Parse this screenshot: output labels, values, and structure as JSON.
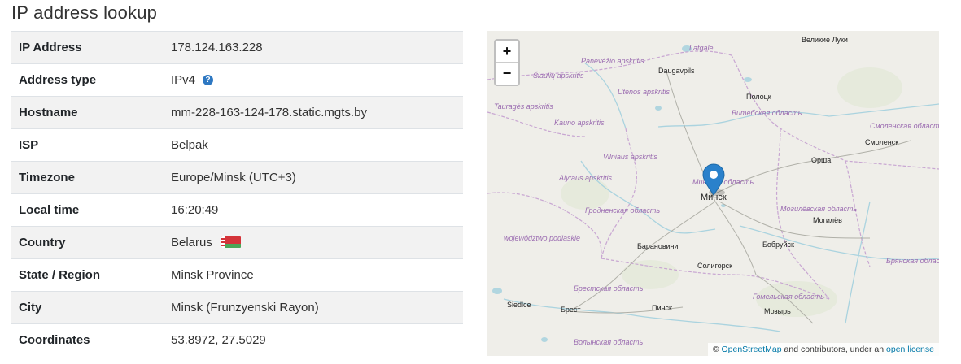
{
  "page": {
    "title": "IP address lookup"
  },
  "table": {
    "rows": [
      {
        "key": "IP Address",
        "value": "178.124.163.228"
      },
      {
        "key": "Address type",
        "value": "IPv4",
        "help_icon": "?"
      },
      {
        "key": "Hostname",
        "value": "mm-228-163-124-178.static.mgts.by"
      },
      {
        "key": "ISP",
        "value": "Belpak"
      },
      {
        "key": "Timezone",
        "value": "Europe/Minsk (UTC+3)"
      },
      {
        "key": "Local time",
        "value": "16:20:49"
      },
      {
        "key": "Country",
        "value": "Belarus",
        "flag": "belarus-flag"
      },
      {
        "key": "State / Region",
        "value": "Minsk Province"
      },
      {
        "key": "City",
        "value": "Minsk (Frunzyenski Rayon)"
      },
      {
        "key": "Coordinates",
        "value": "53.8972, 27.5029"
      }
    ]
  },
  "map": {
    "zoom_in": "+",
    "zoom_out": "−",
    "marker_icon": "map-marker-icon",
    "cities": [
      "Великие Луки",
      "Daugavpils",
      "Полоцк",
      "Смоленск",
      "Орша",
      "Минск",
      "Могилёв",
      "Барановичи",
      "Бобруйск",
      "Солигорск",
      "Брест",
      "Пинск",
      "Мозырь",
      "Siedlce"
    ],
    "regions": [
      "Latgale",
      "Panevėžio apskritis",
      "Šiaulių apskritis",
      "Utenos apskritis",
      "Tauragės apskritis",
      "Витебская область",
      "Kauno apskritis",
      "Смоленская область",
      "Vilniaus apskritis",
      "Alytaus apskritis",
      "Минская область",
      "Гродненская область",
      "Могилёвская область",
      "województwo podlaskie",
      "Брянская область",
      "Брестская область",
      "Гомельская область",
      "Волынская область"
    ],
    "attribution": {
      "prefix": "© ",
      "osm": "OpenStreetMap",
      "middle": " and contributors, under an ",
      "license": "open license"
    }
  }
}
